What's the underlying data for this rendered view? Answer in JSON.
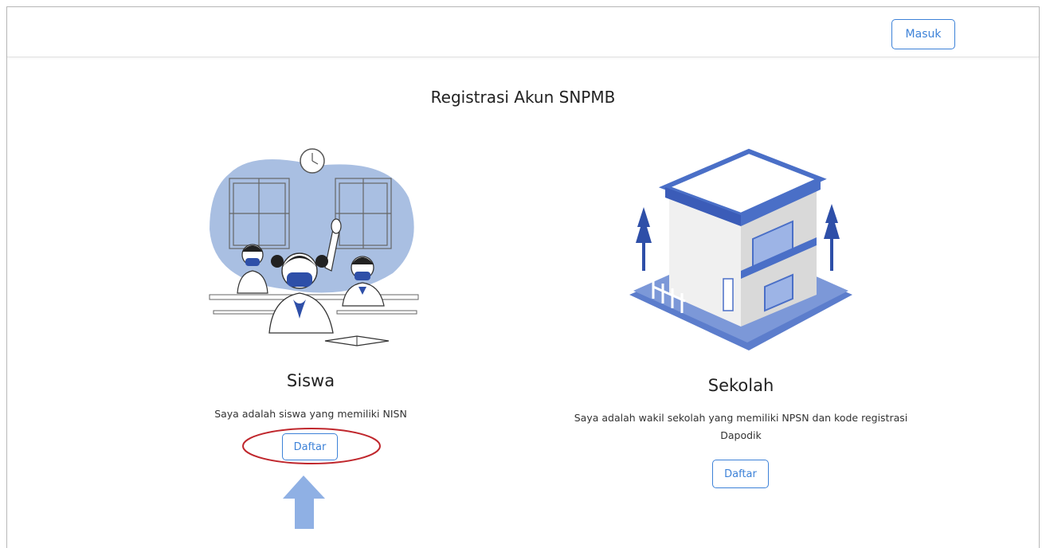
{
  "header": {
    "login_label": "Masuk"
  },
  "page": {
    "title": "Registrasi Akun SNPMB"
  },
  "cards": [
    {
      "title": "Siswa",
      "description": "Saya adalah siswa yang memiliki NISN",
      "button_label": "Daftar",
      "illustration": "students-classroom-illustration"
    },
    {
      "title": "Sekolah",
      "description": "Saya adalah wakil sekolah yang memiliki NPSN dan kode registrasi Dapodik",
      "button_label": "Daftar",
      "illustration": "school-building-illustration"
    }
  ],
  "annotations": {
    "highlight_color": "#c0272d",
    "arrow_color": "#8fb0e4"
  },
  "colors": {
    "accent": "#3d82d8",
    "illustration_blue": "#4a6fc7",
    "illustration_light": "#a9bfe2"
  }
}
